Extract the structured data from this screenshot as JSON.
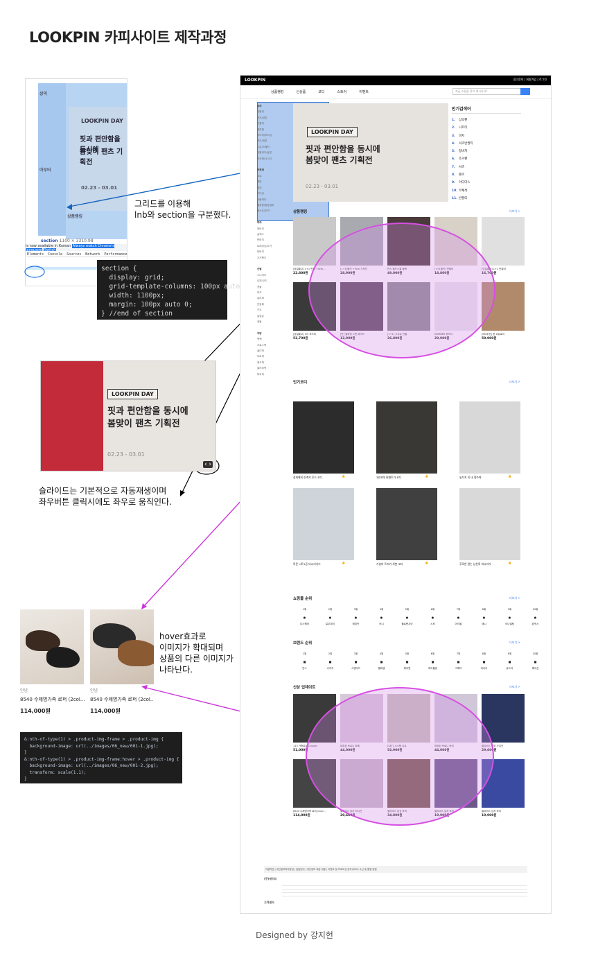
{
  "title": "LOOKPIN 카피사이트 제작과정",
  "notes": {
    "grid": "그리드를 이용해\nlnb와 section을 구분했다.",
    "slide": "슬라이드는 기본적으로 자동재생이며\n좌우버튼 클릭시에도 좌우로 움직인다.",
    "hover": "hover효과로\n이미지가 확대되며\n상품의 다른 이미지가\n나타난다."
  },
  "code": {
    "section": "section {\n  display: grid;\n  grid-template-columns: 100px auto;\n  width: 1100px;\n  margin: 100px auto 0;\n} //end of section",
    "hover": "&:nth-of-type(1) > .product-img-frame > .product-img {\n  background-image: url(../images/06_new/001-1.jpg);\n}\n&:nth-of-type(1) > .product-img-frame:hover > .product-img {\n  background-image: url(../images/06_new/001-2.jpg);\n  transform: scale(1.1);\n}"
  },
  "banner": {
    "badge": "LOOKPIN DAY",
    "line1": "핏과 편안함을 동시에",
    "line2": "봄맞이 팬츠 기획전",
    "date": "02.23 - 03.01"
  },
  "devtools": {
    "section_label": "section",
    "size": "1100 × 3310.98",
    "translate": "is now available in Korean",
    "btn1": "Always match Chrome's language",
    "btn2": "Switch",
    "tabs": [
      "Elements",
      "Console",
      "Sources",
      "Network",
      "Performance"
    ],
    "lnb_top": "상의",
    "lnb_mid": "아우터",
    "sec_label": "상품랭킹"
  },
  "products": [
    {
      "brand": "안녕",
      "name": "8540 수제명가죽 로퍼 (2col...",
      "price": "114,000원"
    },
    {
      "brand": "안녕",
      "name": "8540 수제명가죽 로퍼 (2col...",
      "price": "114,000원"
    }
  ],
  "site": {
    "logo": "LOOKPIN",
    "top_right": "광고문의 | 회원가입 | 로그인",
    "gnb": [
      "상품랭킹",
      "신상품",
      "코디",
      "스토어",
      "이벤트"
    ],
    "search_placeholder": "지금 쇼핑을 찾고 계시나요?",
    "lnb": [
      {
        "h": "상의",
        "items": [
          "반팔티",
          "셔츠/남방",
          "긴팔티",
          "맨투맨",
          "후드티/후드집",
          "후드/집업",
          "니트/스웨터",
          "반팔셔츠/남방",
          "민소매/나시티"
        ]
      },
      {
        "h": "아우터",
        "items": [
          "코트",
          "패딩",
          "재킷",
          "가디건",
          "바람막이",
          "블루종/항공점퍼",
          "베스트/조끼"
        ]
      },
      {
        "h": "하의",
        "items": [
          "청바지",
          "슬랙스",
          "면바지",
          "트레이닝/조거",
          "반바지",
          "조거팬츠"
        ]
      },
      {
        "h": "신발",
        "items": [
          "스니커즈",
          "로퍼/구두",
          "샌들",
          "부츠",
          "슬리퍼",
          "운동화",
          "구두",
          "슬립온",
          "샌들"
        ]
      },
      {
        "h": "가방",
        "items": [
          "백팩",
          "크로스백",
          "숄더백",
          "토트백",
          "에코백",
          "클러치백",
          "파우치"
        ]
      }
    ],
    "ranking": {
      "title": "인기검색어",
      "items": [
        "상의팬",
        "니트티",
        "바지",
        "셔츠반팔티",
        "청바지",
        "조거팬",
        "셔츠",
        "팬츠",
        "아디다스",
        "무채색",
        "반팔티"
      ]
    },
    "sections": {
      "rank": "상품랭킹",
      "codi": "인기코디",
      "shop": "쇼핑몰 순위",
      "brand": "브랜드 순위",
      "newp": "신상 업데이트",
      "more": "더보기 >"
    },
    "cards": [
      {
        "t": "[당일출고] 1+1 반팔 +5cm...",
        "p": "22,800원"
      },
      {
        "t": "[1+1]할인 +5cm 기모진",
        "p": "28,900원"
      },
      {
        "t": "반스 올드스쿨 블랙",
        "p": "49,000원"
      },
      {
        "t": "[1+1할인] 반팔티",
        "p": "18,800원"
      },
      {
        "t": "[당일출고] 1+1 반팔티",
        "p": "16,700원"
      },
      {
        "t": "[당일출고] 5/5 후드티",
        "p": "52,700원"
      },
      {
        "t": "[반] 밀루빙 스판 와이드",
        "p": "12,900원"
      },
      {
        "t": "[1+1] 기우슈 반팔",
        "p": "26,800원"
      },
      {
        "t": "NUMBER 후드티",
        "p": "29,900원"
      },
      {
        "t": "[MD추천] 봄 코듀로이",
        "p": "59,900원"
      }
    ],
    "codi": [
      {
        "t": "경희해외 신액키 후드 코디",
        "n": "233"
      },
      {
        "t": "3만코에 편형트가 코디",
        "n": "156"
      },
      {
        "t": "놓치지 꼭 네 평수화",
        "n": "90"
      },
      {
        "t": "특문 니트1등 바시리거드",
        "n": "263"
      },
      {
        "t": "가성비 트리커 차뿐 코디",
        "n": "82"
      },
      {
        "t": "후로한 깔는 남친룩 바시리거",
        "n": "66"
      }
    ],
    "shops": [
      "디스퀘어",
      "로우데이",
      "매치안",
      "어니",
      "플로렌시아",
      "시보",
      "아이올",
      "애니",
      "이너셀링",
      "쉽셋시"
    ],
    "brands": [
      "반스",
      "나이키",
      "스탠다드",
      "엘비엠",
      "에이앤",
      "레이블링",
      "그루터",
      "커니이",
      "유스더",
      "퀘이션"
    ],
    "newp": [
      {
        "t": "113 가죽로퍼 (2color)",
        "p": "51,000원"
      },
      {
        "t": "퍼퍼된 브로니 파에",
        "p": "44,000원"
      },
      {
        "t": "[SET] 시스템 니트",
        "p": "52,900원"
      },
      {
        "t": "퍼퍼된 브로니 바지",
        "p": "44,000원"
      },
      {
        "t": "멀리비스 남성 가디건",
        "p": "29,600원"
      },
      {
        "t": "8540 수제명가죽 로퍼 (2col...",
        "p": "114,000원"
      },
      {
        "t": "멀리비스 남자 카디건",
        "p": "29,600원"
      },
      {
        "t": "멀리비스 남성 조끼",
        "p": "34,800원"
      },
      {
        "t": "멀리비스 남자 조끼",
        "p": "19,900원"
      },
      {
        "t": "멀리비스 남자 조끼",
        "p": "19,900원"
      }
    ],
    "footer_nav": "이용약관 | 개인정보처리방침 | 입점안내 | 개인정보 제공 내용 | 이벤트 및 프로모션 문자(SMS) 수신 및 활용 방법",
    "footer_company": "(주)에이티",
    "footer_cs": "고객센터"
  },
  "designed": "Designed by 강지현"
}
